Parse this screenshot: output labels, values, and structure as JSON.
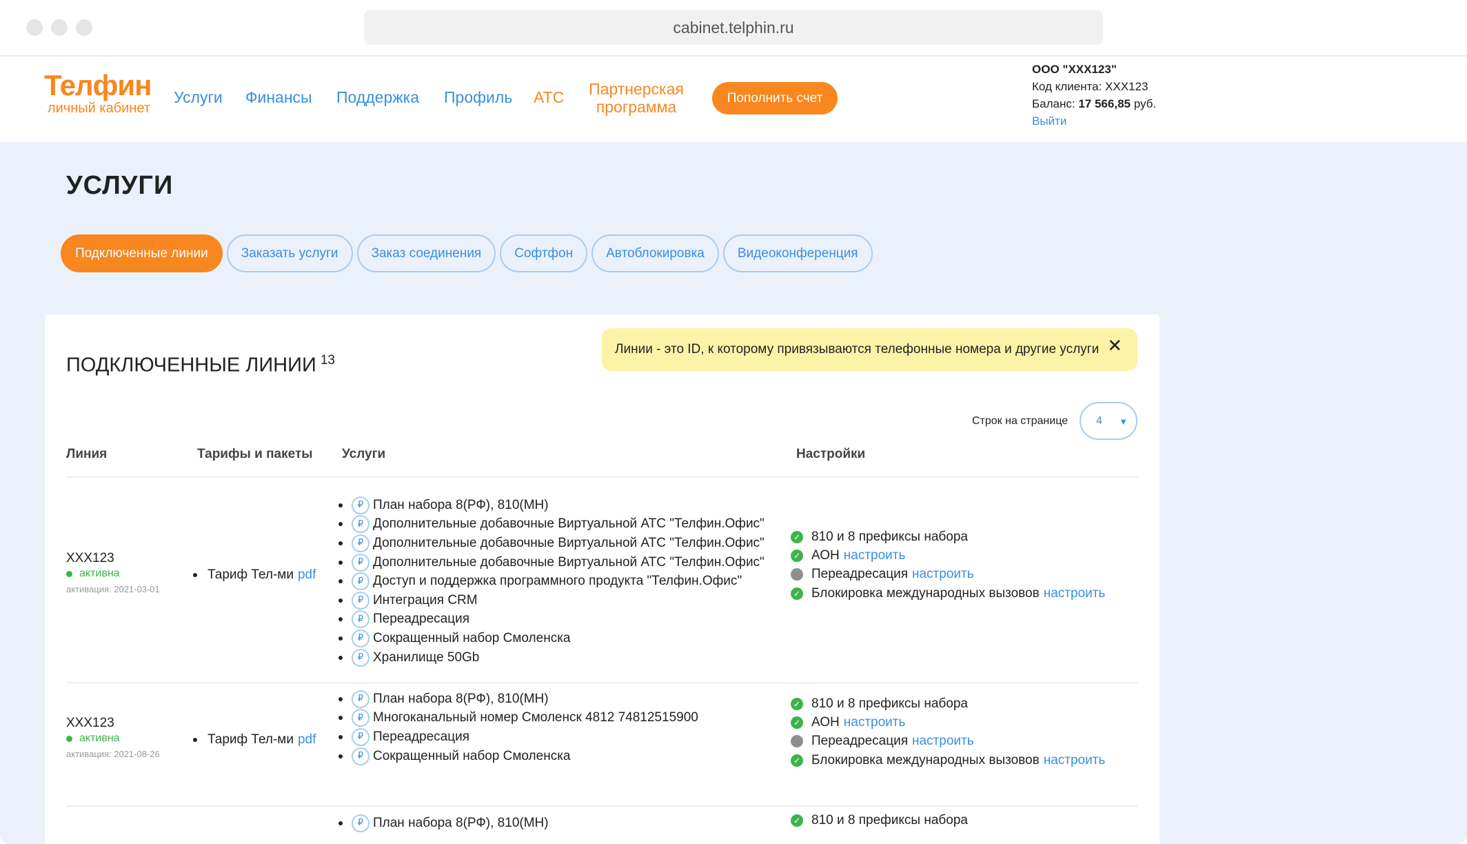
{
  "browser": {
    "url": "cabinet.telphin.ru"
  },
  "header": {
    "logo_title": "Телфин",
    "logo_subtitle": "личный кабинет",
    "nav": {
      "services": "Услуги",
      "finance": "Финансы",
      "support": "Поддержка",
      "profile": "Профиль",
      "pbx": "АТС",
      "partner_line1": "Партнерская",
      "partner_line2": "программа"
    },
    "topup_label": "Пополнить счет",
    "account": {
      "org": "ООО \"XXX123\"",
      "client_code_label": "Код клиента:",
      "client_code": "XXX123",
      "balance_label": "Баланс:",
      "balance_value": "17 566,85",
      "currency": "руб.",
      "logout": "Выйти"
    }
  },
  "page": {
    "title": "УСЛУГИ",
    "tabs": [
      {
        "label": "Подключенные линии",
        "active": true
      },
      {
        "label": "Заказать услуги"
      },
      {
        "label": "Заказ соединения"
      },
      {
        "label": "Софтфон"
      },
      {
        "label": "Автоблокировка"
      },
      {
        "label": "Видеоконференция"
      }
    ]
  },
  "lines": {
    "title": "ПОДКЛЮЧЕННЫЕ ЛИНИИ",
    "count": "13",
    "notice": "Линии - это ID, к которому привязываются телефонные номера и другие услуги",
    "notice_close": "✕",
    "rows_per_page_label": "Строк на странице",
    "rows_per_page_value": "4",
    "columns": {
      "line": "Линия",
      "tariffs": "Тарифы и пакеты",
      "services": "Услуги",
      "settings": "Настройки"
    },
    "rub_symbol": "₽",
    "rows": [
      {
        "id": "XXX123",
        "status": "активна",
        "activation": "активация: 2021-03-01",
        "tariff": "Тариф Тел-ми",
        "tariff_link": "pdf",
        "services": [
          "План набора 8(РФ), 810(МН)",
          "Дополнительные добавочные Виртуальной АТС \"Телфин.Офис\"",
          "Дополнительные добавочные Виртуальной АТС \"Телфин.Офис\"",
          "Дополнительные добавочные Виртуальной АТС \"Телфин.Офис\"",
          "Доступ и поддержка программного продукта \"Телфин.Офис\"",
          "Интеграция CRM",
          "Переадресация",
          "Сокращенный набор Смоленска",
          "Хранилище 50Gb"
        ],
        "settings": [
          {
            "label": "810 и 8 префиксы набора",
            "enabled": true,
            "link": ""
          },
          {
            "label": "АОН",
            "enabled": true,
            "link": "настроить"
          },
          {
            "label": "Переадресация",
            "enabled": false,
            "link": "настроить"
          },
          {
            "label": "Блокировка международных вызовов",
            "enabled": true,
            "link": "настроить"
          }
        ]
      },
      {
        "id": "XXX123",
        "status": "активна",
        "activation": "активация: 2021-08-26",
        "tariff": "Тариф Тел-ми",
        "tariff_link": "pdf",
        "services": [
          "План набора 8(РФ), 810(МН)",
          "Многоканальный номер Смоленск 4812 74812515900",
          "Переадресация",
          "Сокращенный набор Смоленска"
        ],
        "settings": [
          {
            "label": "810 и 8 префиксы набора",
            "enabled": true,
            "link": ""
          },
          {
            "label": "АОН",
            "enabled": true,
            "link": "настроить"
          },
          {
            "label": "Переадресация",
            "enabled": false,
            "link": "настроить"
          },
          {
            "label": "Блокировка международных вызовов",
            "enabled": true,
            "link": "настроить"
          }
        ]
      },
      {
        "services": [
          "План набора 8(РФ), 810(МН)"
        ],
        "settings": [
          {
            "label": "810 и 8 префиксы набора",
            "enabled": true,
            "link": ""
          }
        ]
      }
    ]
  }
}
